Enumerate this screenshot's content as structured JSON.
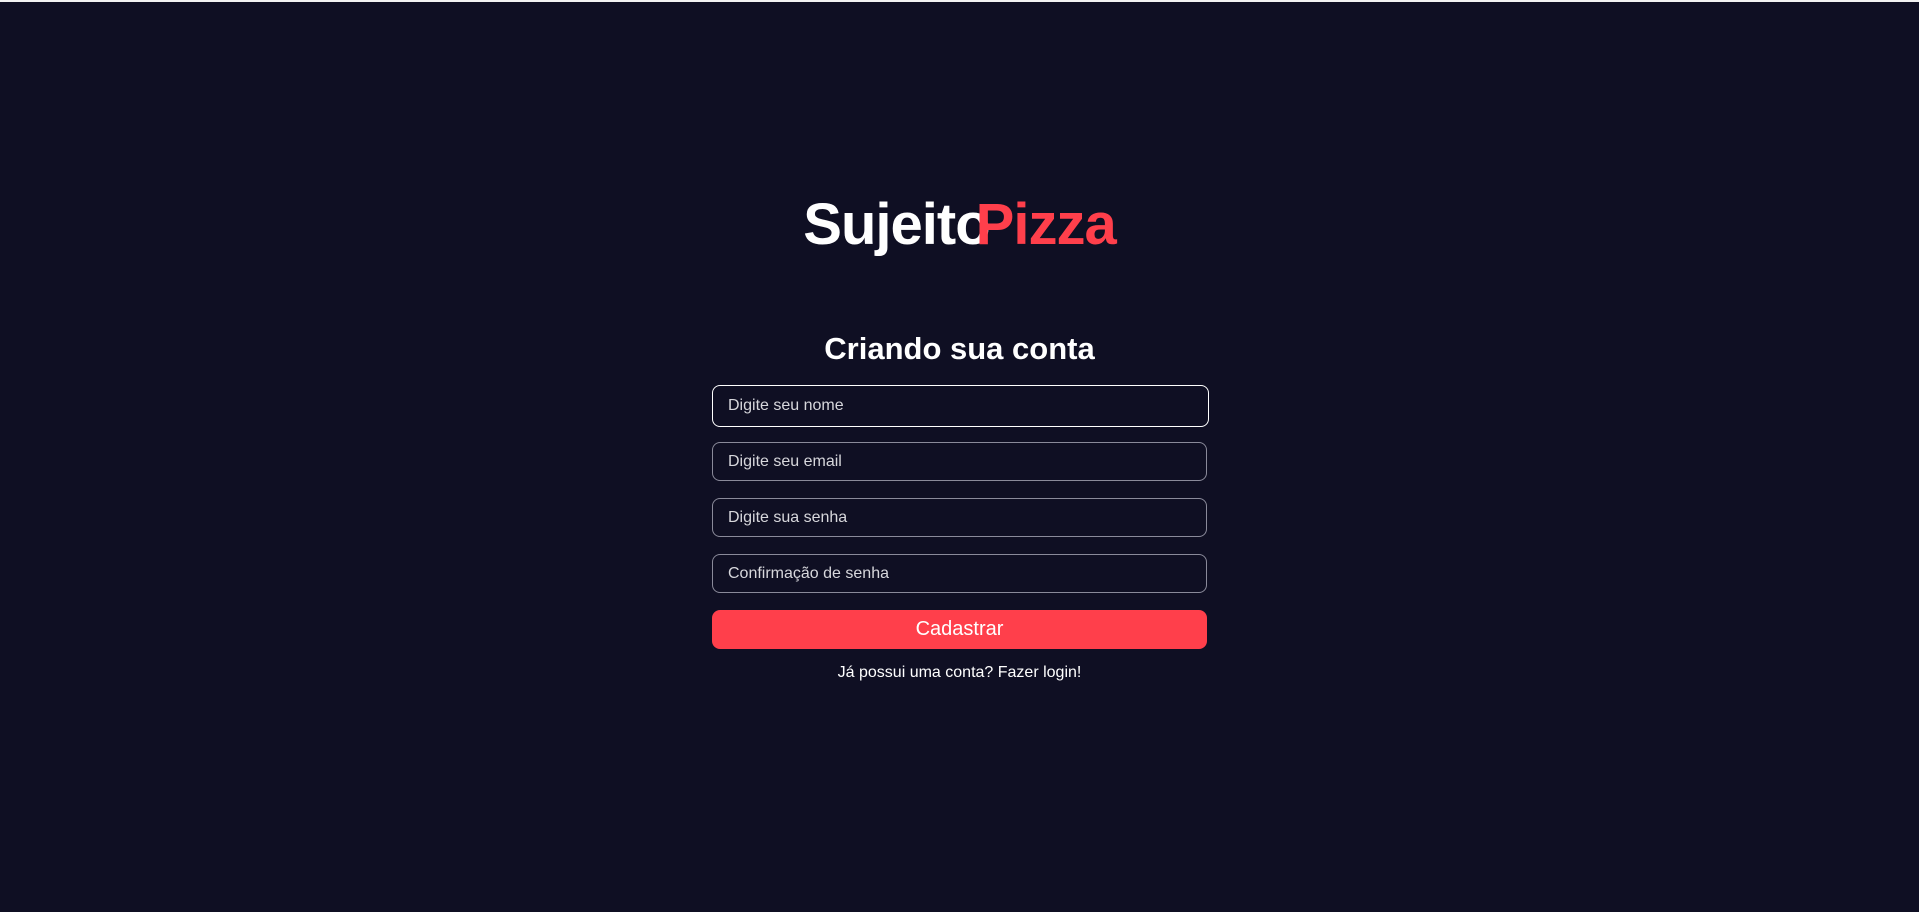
{
  "brand": {
    "part1": "Sujeito",
    "part2": "Pizza",
    "part2_color": "#ff3f4b"
  },
  "form": {
    "title": "Criando sua conta",
    "fields": [
      {
        "placeholder": "Digite seu nome",
        "value": "",
        "focused": true
      },
      {
        "placeholder": "Digite seu email",
        "value": ""
      },
      {
        "placeholder": "Digite sua senha",
        "value": ""
      },
      {
        "placeholder": "Confirmação de senha",
        "value": ""
      }
    ],
    "submit_label": "Cadastrar",
    "login_link": "Já possui uma conta? Fazer login!"
  },
  "colors": {
    "background": "#0f0f23",
    "accent": "#ff3f4b",
    "text": "#ffffff"
  }
}
